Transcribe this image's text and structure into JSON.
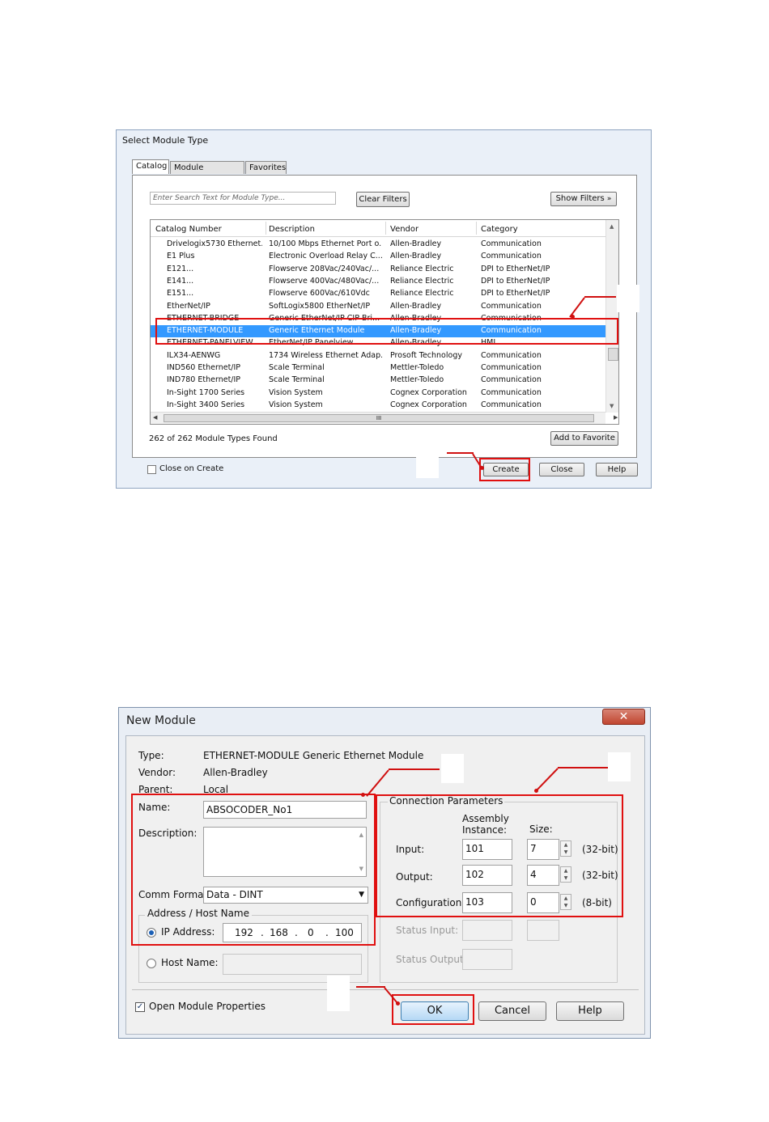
{
  "select_dialog": {
    "title": "Select Module Type",
    "tabs": [
      "Catalog",
      "Module Discovery",
      "Favorites"
    ],
    "search_placeholder": "Enter Search Text for Module Type...",
    "clear_filters": "Clear Filters",
    "show_filters": "Show Filters",
    "show_filters_icon": "double-chevron-down",
    "columns": [
      "Catalog Number",
      "Description",
      "Vendor",
      "Category"
    ],
    "rows": [
      [
        "Drivelogix5730 Ethernet...",
        "10/100 Mbps Ethernet Port o...",
        "Allen-Bradley",
        "Communication"
      ],
      [
        "E1 Plus",
        "Electronic Overload Relay C...",
        "Allen-Bradley",
        "Communication"
      ],
      [
        "E121...",
        "Flowserve 208Vac/240Vac/...",
        "Reliance Electric",
        "DPI to EtherNet/IP"
      ],
      [
        "E141...",
        "Flowserve 400Vac/480Vac/...",
        "Reliance Electric",
        "DPI to EtherNet/IP"
      ],
      [
        "E151...",
        "Flowserve 600Vac/610Vdc",
        "Reliance Electric",
        "DPI to EtherNet/IP"
      ],
      [
        "EtherNet/IP",
        "SoftLogix5800 EtherNet/IP",
        "Allen-Bradley",
        "Communication"
      ],
      [
        "ETHERNET-BRIDGE",
        "Generic EtherNet/IP CIP Bri...",
        "Allen-Bradley",
        "Communication"
      ],
      [
        "ETHERNET-MODULE",
        "Generic Ethernet Module",
        "Allen-Bradley",
        "Communication"
      ],
      [
        "ETHERNET-PANELVIEW",
        "EtherNet/IP Panelview",
        "Allen-Bradley",
        "HMI"
      ],
      [
        "ILX34-AENWG",
        "1734 Wireless Ethernet Adap...",
        "Prosoft Technology",
        "Communication"
      ],
      [
        "IND560 Ethernet/IP",
        "Scale Terminal",
        "Mettler-Toledo",
        "Communication"
      ],
      [
        "IND780 Ethernet/IP",
        "Scale Terminal",
        "Mettler-Toledo",
        "Communication"
      ],
      [
        "In-Sight 1700 Series",
        "Vision System",
        "Cognex Corporation",
        "Communication"
      ],
      [
        "In-Sight 3400 Series",
        "Vision System",
        "Cognex Corporation",
        "Communication"
      ]
    ],
    "selected_row": 7,
    "found_text": "262  of 262 Module Types Found",
    "add_favorite": "Add to Favorite",
    "close_on_create": "Close on Create",
    "close_on_create_checked": false,
    "create": "Create",
    "close": "Close",
    "help": "Help",
    "hscroll_mark": "III"
  },
  "new_module": {
    "title": "New Module",
    "close_icon": "close-x",
    "type_label": "Type:",
    "type_value": "ETHERNET-MODULE Generic Ethernet Module",
    "vendor_label": "Vendor:",
    "vendor_value": "Allen-Bradley",
    "parent_label": "Parent:",
    "parent_value": "Local",
    "name_label": "Name:",
    "name_value": "ABSOCODER_No1",
    "description_label": "Description:",
    "comm_format_label": "Comm Format:",
    "comm_format_value": "Data - DINT",
    "address_group": "Address / Host Name",
    "ip_label": "IP Address:",
    "ip": [
      "192",
      "168",
      "0",
      "100"
    ],
    "host_label": "Host Name:",
    "conn_params": "Connection Parameters",
    "assembly_instance": "Assembly Instance:",
    "size": "Size:",
    "params": [
      {
        "label": "Input:",
        "instance": "101",
        "size": "7",
        "unit": "(32-bit)"
      },
      {
        "label": "Output:",
        "instance": "102",
        "size": "4",
        "unit": "(32-bit)"
      },
      {
        "label": "Configuration:",
        "instance": "103",
        "size": "0",
        "unit": "(8-bit)"
      }
    ],
    "status_input": "Status Input:",
    "status_output": "Status Output:",
    "open_props": "Open Module Properties",
    "open_props_checked": true,
    "ok": "OK",
    "cancel": "Cancel",
    "help": "Help"
  },
  "annotation_color": "#e01010"
}
